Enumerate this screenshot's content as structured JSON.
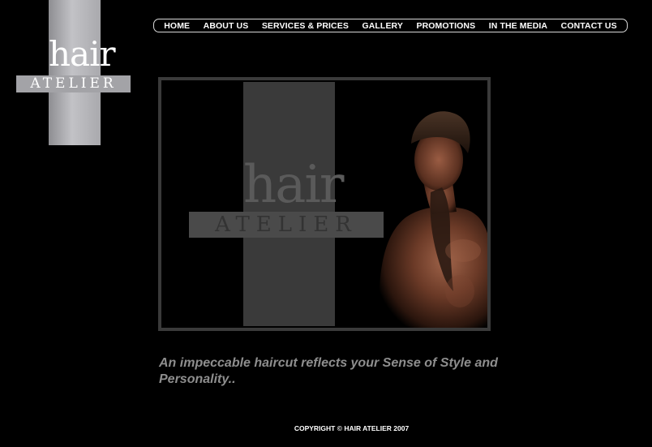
{
  "brand": {
    "logo_word_top": "hair",
    "logo_word_bottom": "ATELIER"
  },
  "nav": {
    "items": [
      {
        "label": "HOME"
      },
      {
        "label": "ABOUT US"
      },
      {
        "label": "SERVICES & PRICES"
      },
      {
        "label": "GALLERY"
      },
      {
        "label": "PROMOTIONS"
      },
      {
        "label": "IN THE MEDIA"
      },
      {
        "label": "CONTACT US"
      }
    ]
  },
  "hero": {
    "logo_word_top": "hair",
    "logo_word_bottom": "ATELIER"
  },
  "tagline": "An impeccable haircut reflects your Sense of Style and Personality..",
  "footer": {
    "copyright": "COPYRIGHT © HAIR ATELIER 2007"
  },
  "colors": {
    "background": "#000000",
    "logo_silver": "#a3a3a7",
    "hero_gray": "#3a3a3a",
    "tagline": "#8e8e8e"
  }
}
